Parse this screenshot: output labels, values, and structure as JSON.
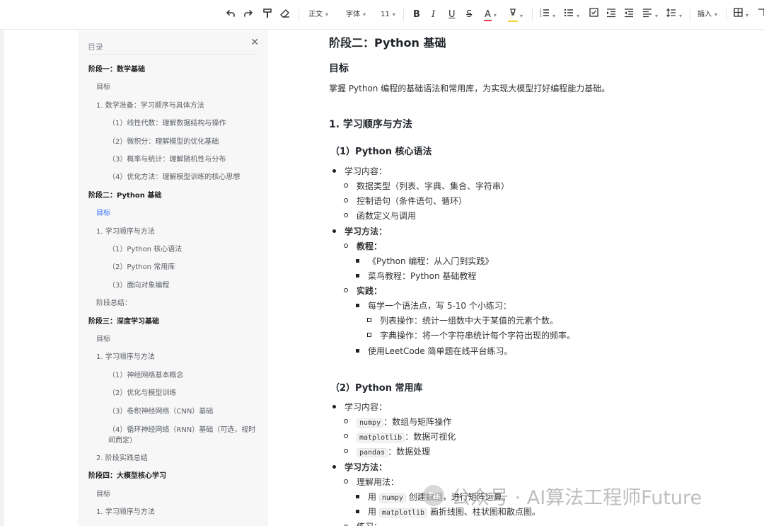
{
  "toolbar": {
    "text_style": "正文",
    "font_family": "字体",
    "font_size": "11",
    "bold": "B",
    "italic": "I",
    "underline": "U",
    "strike": "S",
    "font_color": "A",
    "insert": "插入",
    "accent_color": "#e1433d",
    "highlight_color": "#f5d232"
  },
  "toc": {
    "title": "目录",
    "close": "✕",
    "items": [
      {
        "label": "阶段一：数学基础",
        "level": 1
      },
      {
        "label": "目标",
        "level": 2
      },
      {
        "label": "1. 数学准备：学习顺序与具体方法",
        "level": 2
      },
      {
        "label": "（1）线性代数：理解数据结构与操作",
        "level": 3
      },
      {
        "label": "（2）微积分：理解模型的优化基础",
        "level": 3
      },
      {
        "label": "（3）概率与统计：理解随机性与分布",
        "level": 3
      },
      {
        "label": "（4）优化方法：理解模型训练的核心思想",
        "level": 3
      },
      {
        "label": "阶段二：Python 基础",
        "level": 1
      },
      {
        "label": "目标",
        "level": 2,
        "active": true
      },
      {
        "label": "1. 学习顺序与方法",
        "level": 2
      },
      {
        "label": "（1）Python 核心语法",
        "level": 3
      },
      {
        "label": "（2）Python 常用库",
        "level": 3
      },
      {
        "label": "（3）面向对象编程",
        "level": 3
      },
      {
        "label": "阶段总结：",
        "level": 2
      },
      {
        "label": "阶段三：深度学习基础",
        "level": 1
      },
      {
        "label": "目标",
        "level": 2
      },
      {
        "label": "1. 学习顺序与方法",
        "level": 2
      },
      {
        "label": "（1）神经网络基本概念",
        "level": 3
      },
      {
        "label": "（2）优化与模型训练",
        "level": 3
      },
      {
        "label": "（3）卷积神经网络（CNN）基础",
        "level": 3
      },
      {
        "label": "（4）循环神经网络（RNN）基础（可选，视时间而定）",
        "level": 3
      },
      {
        "label": "2. 阶段实践总结",
        "level": 2
      },
      {
        "label": "阶段四：大模型核心学习",
        "level": 1
      },
      {
        "label": "目标",
        "level": 2
      },
      {
        "label": "1. 学习顺序与方法",
        "level": 2
      }
    ],
    "active_color": "#3370ff"
  },
  "doc": {
    "h_stage": "阶段二：Python 基础",
    "h_goal": "目标",
    "goal_text": "掌握 Python 编程的基础语法和常用库，为实现大模型打好编程能力基础。",
    "h_order": "1. 学习顺序与方法",
    "s1": {
      "title": "（1）Python 核心语法",
      "content_label": "学习内容：",
      "content_items": [
        "数据类型（列表、字典、集合、字符串）",
        "控制语句（条件语句、循环）",
        "函数定义与调用"
      ],
      "method_label": "学习方法：",
      "tutorial_label": "教程：",
      "tutorials": [
        "《Python 编程：从入门到实践》",
        "菜鸟教程：Python 基础教程"
      ],
      "practice_label": "实践：",
      "practice_main": "每学一个语法点，写 5-10 个小练习：",
      "practice_sub": [
        "列表操作：统计一组数中大于某值的元素个数。",
        "字典操作：将一个字符串统计每个字符出现的频率。"
      ],
      "practice_last": "使用LeetCode 简单题在线平台练习。"
    },
    "s2": {
      "title": "（2）Python 常用库",
      "content_label": "学习内容：",
      "libs": [
        {
          "code": "numpy",
          "text": "：数组与矩阵操作"
        },
        {
          "code": "matplotlib",
          "text": "：数据可视化"
        },
        {
          "code": "pandas",
          "text": "：数据处理"
        }
      ],
      "method_label": "学习方法：",
      "understand_label": "理解用法：",
      "use1_pre": "用",
      "use1_code": "numpy",
      "use1_text": "创建数组，进行矩阵运算。",
      "use2_pre": "用",
      "use2_code": "matplotlib",
      "use2_text": "画折线图、柱状图和散点图。",
      "practice_label": "练习："
    }
  },
  "watermark": "公众号 · AI算法工程师Future"
}
